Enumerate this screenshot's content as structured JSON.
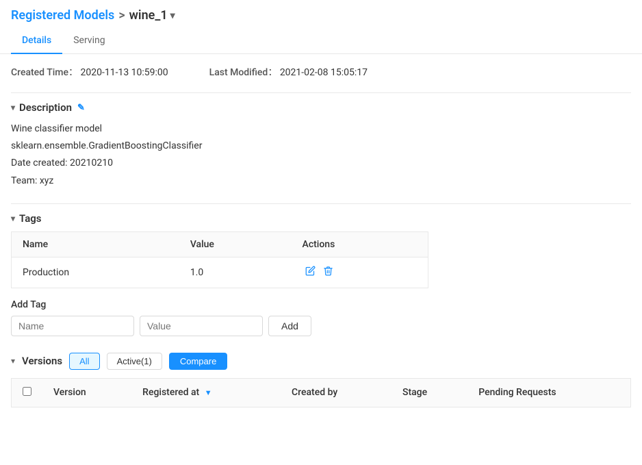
{
  "header": {
    "breadcrumb_link": "Registered Models",
    "separator": ">",
    "model_name": "wine_1",
    "dropdown_symbol": "▾"
  },
  "tabs": [
    {
      "id": "details",
      "label": "Details",
      "active": true
    },
    {
      "id": "serving",
      "label": "Serving",
      "active": false
    }
  ],
  "meta": {
    "created_label": "Created Time：",
    "created_value": "2020-11-13 10:59:00",
    "modified_label": "Last Modified：",
    "modified_value": "2021-02-08 15:05:17"
  },
  "description": {
    "section_label": "Description",
    "toggle": "▾",
    "edit_icon": "✎",
    "lines": [
      "Wine classifier model",
      "sklearn.ensemble.GradientBoostingClassifier",
      "Date created: 20210210",
      "Team: xyz"
    ]
  },
  "tags": {
    "section_label": "Tags",
    "toggle": "▾",
    "columns": [
      "Name",
      "Value",
      "Actions"
    ],
    "rows": [
      {
        "name": "Production",
        "value": "1.0"
      }
    ]
  },
  "add_tag": {
    "label": "Add Tag",
    "name_placeholder": "Name",
    "value_placeholder": "Value",
    "button_label": "Add"
  },
  "versions": {
    "section_label": "Versions",
    "toggle": "▾",
    "filters": [
      {
        "label": "All",
        "active": true
      },
      {
        "label": "Active(1)",
        "active": false
      }
    ],
    "compare_label": "Compare",
    "columns": [
      "",
      "Version",
      "Registered at",
      "Created by",
      "Stage",
      "Pending Requests"
    ]
  },
  "icons": {
    "edit": "✏️",
    "delete": "🗑",
    "sort_down": "▼"
  }
}
